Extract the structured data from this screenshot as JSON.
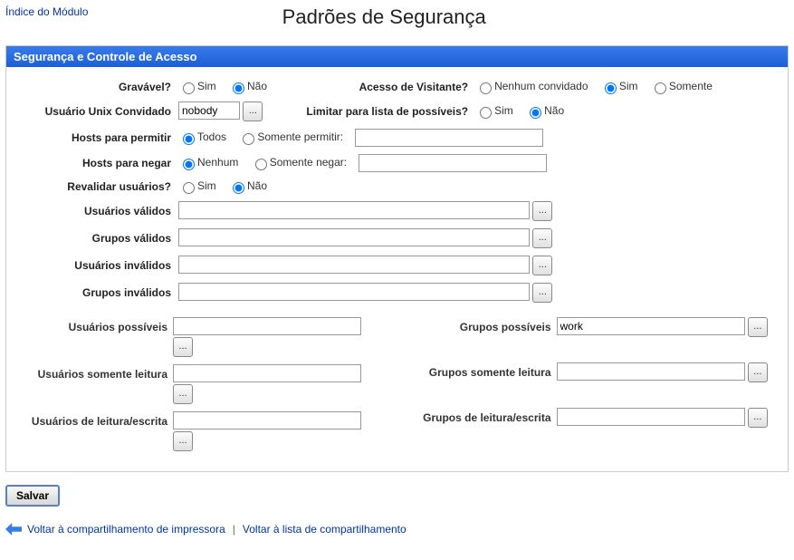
{
  "header": {
    "module_index": "Índice do Módulo",
    "title": "Padrões de Segurança"
  },
  "panel": {
    "title": "Segurança e Controle de Acesso"
  },
  "labels": {
    "writable": "Gravável?",
    "guest_access": "Acesso de Visitante?",
    "guest_unix_user": "Usuário Unix Convidado",
    "limit_possible": "Limitar para lista de possíveis?",
    "hosts_allow": "Hosts para permitir",
    "hosts_deny": "Hosts para negar",
    "revalidate": "Revalidar usuários?",
    "valid_users": "Usuários válidos",
    "valid_groups": "Grupos válidos",
    "invalid_users": "Usuários inválidos",
    "invalid_groups": "Grupos inválidos",
    "possible_users": "Usuários possíveis",
    "possible_groups": "Grupos possíveis",
    "ro_users": "Usuários somente leitura",
    "ro_groups": "Grupos somente leitura",
    "rw_users": "Usuários de leitura/escrita",
    "rw_groups": "Grupos de leitura/escrita"
  },
  "options": {
    "yes": "Sim",
    "no": "Não",
    "none_guest": "Nenhum convidado",
    "only": "Somente",
    "all": "Todos",
    "allow_only": "Somente permitir:",
    "none": "Nenhum",
    "deny_only": "Somente negar:"
  },
  "values": {
    "writable": "no",
    "guest_access": "yes",
    "guest_unix_user": "nobody",
    "limit_possible": "no",
    "hosts_allow_mode": "all",
    "hosts_allow_text": "",
    "hosts_deny_mode": "none",
    "hosts_deny_text": "",
    "revalidate": "no",
    "valid_users": "",
    "valid_groups": "",
    "invalid_users": "",
    "invalid_groups": "",
    "possible_users": "",
    "possible_groups": "work",
    "ro_users": "",
    "ro_groups": "",
    "rw_users": "",
    "rw_groups": ""
  },
  "buttons": {
    "browse": "...",
    "save": "Salvar"
  },
  "footer": {
    "back_printer": "Voltar à compartilhamento de impressora",
    "back_list": "Voltar à lista de compartilhamento",
    "sep": "|"
  }
}
